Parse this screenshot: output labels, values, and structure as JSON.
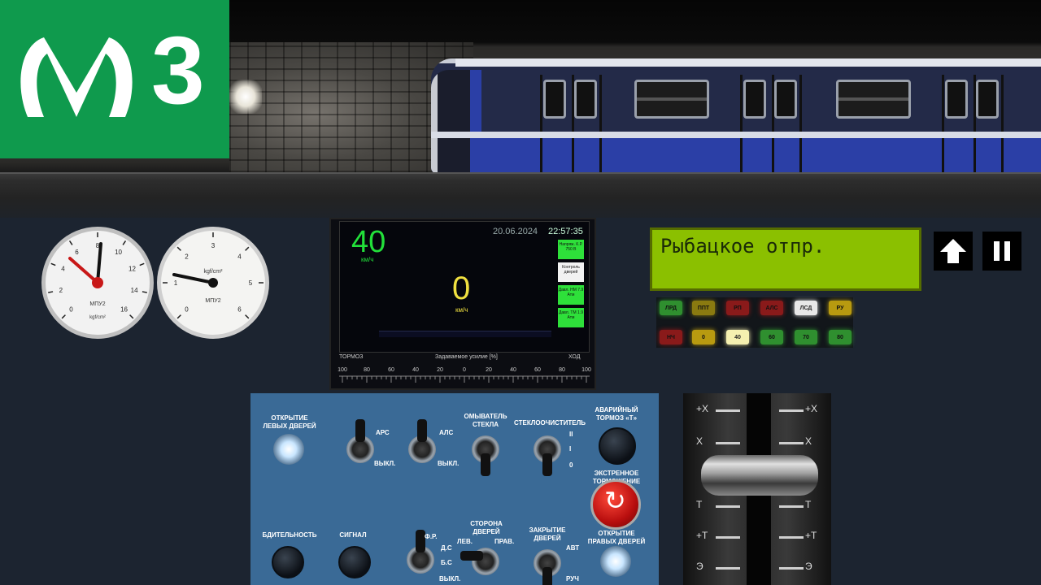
{
  "logo": {
    "line_number": "3",
    "brand_color": "#0f9a4d"
  },
  "gauges": [
    {
      "label": "МПУ2",
      "unit": "kgf/cm²",
      "ticks": [
        "0",
        "2",
        "4",
        "6",
        "8",
        "10",
        "12",
        "14",
        "16"
      ]
    },
    {
      "label": "МПУ2",
      "unit": "kgf/cm²",
      "ticks": [
        "0",
        "1",
        "2",
        "3",
        "4",
        "5",
        "6"
      ]
    }
  ],
  "display": {
    "speed_limit": "40",
    "speed_limit_unit": "км/ч",
    "date": "20.06.2024",
    "time": "22:57:35",
    "speed": "0",
    "speed_unit": "км/ч",
    "side_indicators": [
      {
        "text": "Напряж. К.Р. 750 В",
        "color": "#2ee03a"
      },
      {
        "text": "Контроль дверей",
        "color": "#f2f2f2"
      },
      {
        "text": "Давл. НМ 7.9 Атм",
        "color": "#2ee03a"
      },
      {
        "text": "Давл. ТМ 1.9 Атм",
        "color": "#2ee03a"
      }
    ],
    "scale": {
      "left_label": "ТОРМОЗ",
      "center_label": "Задаваемое усилие [%]",
      "right_label": "ХОД",
      "ticks": [
        "100",
        "80",
        "60",
        "40",
        "20",
        "0",
        "20",
        "40",
        "60",
        "80",
        "100"
      ]
    }
  },
  "station": {
    "text": "Рыбацкое отпр."
  },
  "buttons": {
    "up_icon": "arrow-up-icon",
    "pause_icon": "pause-icon"
  },
  "indicators": {
    "row1": [
      {
        "label": "ЛРД",
        "color": "#2f8f2f"
      },
      {
        "label": "ППТ",
        "color": "#8a7a10"
      },
      {
        "label": "РП",
        "color": "#8a1a1a"
      },
      {
        "label": "АЛС",
        "color": "#8a1a1a"
      },
      {
        "label": "ЛСД",
        "color": "#e8e8e8"
      },
      {
        "label": "РУ",
        "color": "#b89a10"
      }
    ],
    "row2": [
      {
        "label": "НЧ",
        "color": "#8a1a1a"
      },
      {
        "label": "0",
        "color": "#b89a10"
      },
      {
        "label": "40",
        "color": "#f5f0b0"
      },
      {
        "label": "60",
        "color": "#2f8f2f"
      },
      {
        "label": "70",
        "color": "#2f8f2f"
      },
      {
        "label": "80",
        "color": "#2f8f2f"
      }
    ]
  },
  "panel": {
    "open_left_doors": "ОТКРЫТИЕ ЛЕВЫХ ДВЕРЕЙ",
    "ars": "АРС",
    "off1": "ВЫКЛ.",
    "als": "АЛС",
    "off2": "ВЫКЛ.",
    "washer": "ОМЫВАТЕЛЬ СТЕКЛА",
    "wiper": "СТЕКЛООЧИСТИТЕЛЬ",
    "wiper_ii": "II",
    "wiper_i": "I",
    "wiper_0": "0",
    "emergency_brake": "АВАРИЙНЫЙ ТОРМОЗ «Т»",
    "extreme_braking": "ЭКСТРЕННОЕ ТОРМОЖЕНИЕ",
    "vigilance": "БДИТЕЛЬНОСТЬ",
    "signal": "СИГНАЛ",
    "fr": "Ф.Р.",
    "ds": "Д.С",
    "bs": "Б.С",
    "off3": "ВЫКЛ.",
    "door_side": "СТОРОНА ДВЕРЕЙ",
    "left": "ЛЕВ.",
    "right": "ПРАВ.",
    "close_doors": "ЗАКРЫТИЕ ДВЕРЕЙ",
    "auto": "АВТ",
    "manual": "РУЧ",
    "open_right_doors": "ОТКРЫТИЕ ПРАВЫХ ДВЕРЕЙ"
  },
  "controller": {
    "left_positions": [
      "+X",
      "X",
      "T",
      "+T",
      "Э"
    ],
    "right_positions": [
      "+X",
      "X",
      "T",
      "+T",
      "Э"
    ]
  }
}
